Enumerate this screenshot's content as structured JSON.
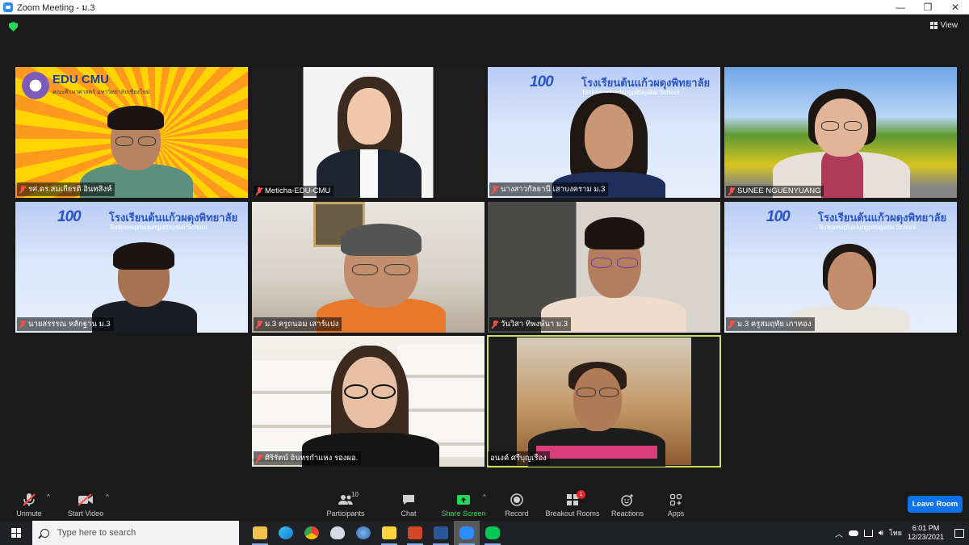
{
  "window": {
    "title": "Zoom Meeting - ม.3",
    "minimize": "—",
    "maximize": "❐",
    "close": "✕"
  },
  "header": {
    "view_label": "View"
  },
  "banners": {
    "edu_title": "EDU CMU",
    "edu_subtitle": "คณะศึกษาศาสตร์ มหาวิทยาลัยเชียงใหม่",
    "school_title": "โรงเรียนต้นแก้วผดุงพิทยาลัย",
    "school_subtitle": "Tonkaewphadungpittayalai School",
    "school_logo": "100"
  },
  "participants": [
    {
      "name": "รศ.ดร.สมเกียรติ อินทสิงห์",
      "muted": true
    },
    {
      "name": "Meticha-EDU-CMU",
      "muted": true
    },
    {
      "name": "นางสาวกัลยานี เสาบงคราม ม.3",
      "muted": true
    },
    {
      "name": "SUNEE NGUENYUANG",
      "muted": true
    },
    {
      "name": "นายสรรรณ หลักฐาน ม.3",
      "muted": true
    },
    {
      "name": "ม.3 ครูถนอม เสาร์แปง",
      "muted": true
    },
    {
      "name": "วันวิสา ทิพงษ์นา ม.3",
      "muted": true
    },
    {
      "name": "ม.3 ครูสมฤทัย เกาทอง",
      "muted": true
    },
    {
      "name": "ศิริรัตน์ อินทรกำแหง รองผอ.",
      "muted": true
    },
    {
      "name": "อนงค์ ศรีบุญเรือง",
      "muted": false
    }
  ],
  "toolbar": {
    "unmute": "Unmute",
    "start_video": "Start Video",
    "participants": "Participants",
    "participants_count": "10",
    "chat": "Chat",
    "share_screen": "Share Screen",
    "record": "Record",
    "breakout_rooms": "Breakout Rooms",
    "breakout_badge": "1",
    "reactions": "Reactions",
    "apps": "Apps",
    "leave_room": "Leave Room",
    "caret": "^"
  },
  "taskbar": {
    "search_placeholder": "Type here to search",
    "language": "ไทย",
    "time": "6:01 PM",
    "date": "12/23/2021"
  },
  "colors": {
    "zoom_blue": "#0e72ed",
    "share_green": "#23d959",
    "active_speaker": "#c8e05a",
    "muted_red": "#ff4d4d"
  }
}
